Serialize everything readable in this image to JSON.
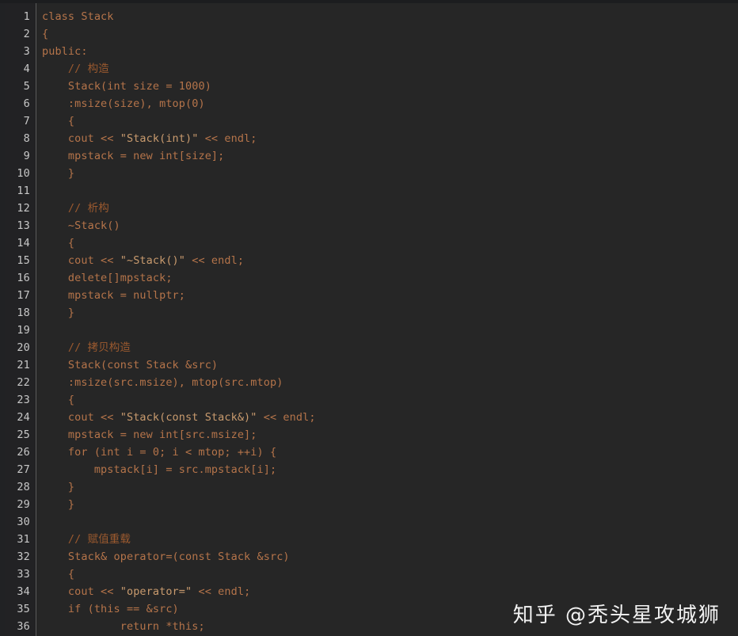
{
  "editor": {
    "language": "cpp",
    "theme": "dark",
    "background_color": "#262626",
    "gutter_color": "#222224",
    "line_number_color": "#c8c8c8",
    "code_color": "#b5744a",
    "comment_color": "#9c5a2f",
    "string_color": "#c99b6e",
    "first_visible_line": 1,
    "last_visible_line": 36,
    "total_visible_lines": 36,
    "line_height_px": 22
  },
  "watermark": {
    "text": "知乎 @秃头星攻城狮",
    "color": "#f2f2f2"
  },
  "lines": [
    {
      "n": "1",
      "text": "class Stack"
    },
    {
      "n": "2",
      "text": "{"
    },
    {
      "n": "3",
      "text": "public:"
    },
    {
      "n": "4",
      "text": "    // 构造",
      "kind": "comment"
    },
    {
      "n": "5",
      "text": "    Stack(int size = 1000)"
    },
    {
      "n": "6",
      "text": "    :msize(size), mtop(0)"
    },
    {
      "n": "7",
      "text": "    {"
    },
    {
      "n": "8",
      "text": "    cout << \"Stack(int)\" << endl;"
    },
    {
      "n": "9",
      "text": "    mpstack = new int[size];"
    },
    {
      "n": "10",
      "text": "    }"
    },
    {
      "n": "11",
      "text": ""
    },
    {
      "n": "12",
      "text": "    // 析构",
      "kind": "comment"
    },
    {
      "n": "13",
      "text": "    ~Stack()"
    },
    {
      "n": "14",
      "text": "    {"
    },
    {
      "n": "15",
      "text": "    cout << \"~Stack()\" << endl;"
    },
    {
      "n": "16",
      "text": "    delete[]mpstack;"
    },
    {
      "n": "17",
      "text": "    mpstack = nullptr;"
    },
    {
      "n": "18",
      "text": "    }"
    },
    {
      "n": "19",
      "text": ""
    },
    {
      "n": "20",
      "text": "    // 拷贝构造",
      "kind": "comment"
    },
    {
      "n": "21",
      "text": "    Stack(const Stack &src)"
    },
    {
      "n": "22",
      "text": "    :msize(src.msize), mtop(src.mtop)"
    },
    {
      "n": "23",
      "text": "    {"
    },
    {
      "n": "24",
      "text": "    cout << \"Stack(const Stack&)\" << endl;"
    },
    {
      "n": "25",
      "text": "    mpstack = new int[src.msize];"
    },
    {
      "n": "26",
      "text": "    for (int i = 0; i < mtop; ++i) {"
    },
    {
      "n": "27",
      "text": "        mpstack[i] = src.mpstack[i];"
    },
    {
      "n": "28",
      "text": "    }"
    },
    {
      "n": "29",
      "text": "    }"
    },
    {
      "n": "30",
      "text": ""
    },
    {
      "n": "31",
      "text": "    // 赋值重载",
      "kind": "comment"
    },
    {
      "n": "32",
      "text": "    Stack& operator=(const Stack &src)"
    },
    {
      "n": "33",
      "text": "    {"
    },
    {
      "n": "34",
      "text": "    cout << \"operator=\" << endl;"
    },
    {
      "n": "35",
      "text": "    if (this == &src)"
    },
    {
      "n": "36",
      "text": "            return *this;"
    }
  ]
}
